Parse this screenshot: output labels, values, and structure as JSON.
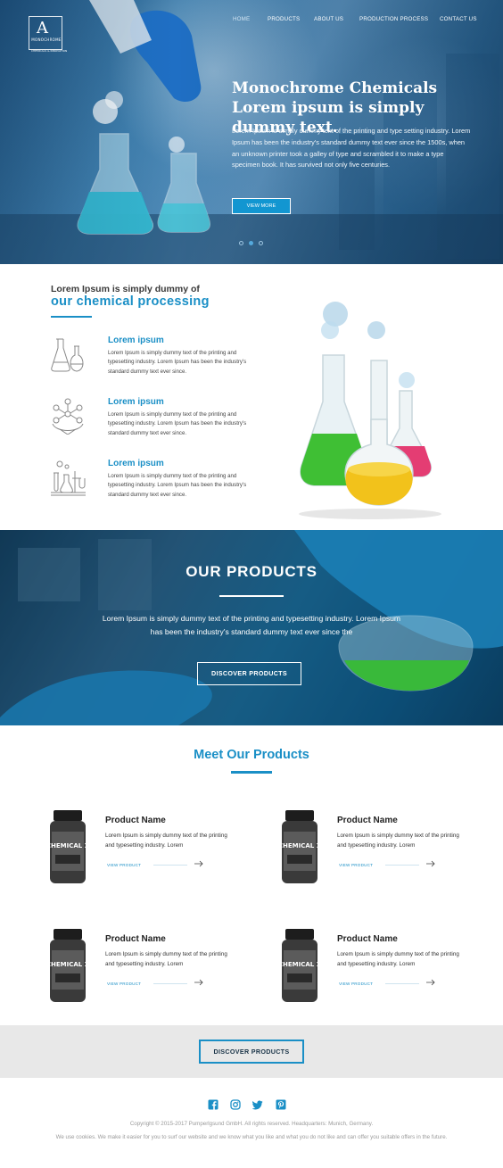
{
  "brand": {
    "logo_mark": "A",
    "name": "MONOCHROME",
    "tagline": "CHEMICALS & INNOVATION"
  },
  "nav": {
    "items": [
      "HOME",
      "PRODUCTS",
      "ABOUT US",
      "PRODUCTION PROCESS",
      "CONTACT US"
    ],
    "active": "HOME"
  },
  "hero": {
    "title": "Monochrome Chemicals Lorem ipsum is simply dummy text.",
    "text": "Lorem Ipsum is simply dummy text of the printing and type setting industry. Lorem Ipsum has been the industry's standard dummy text ever since the 1500s, when an unknown printer took a galley of type and scrambled it to make a type specimen book. It has survived not only five centuries.",
    "button": "VIEW MORE",
    "slides": 3,
    "active_slide": 2
  },
  "processing": {
    "pretitle": "Lorem Ipsum is simply dummy of",
    "title": "our chemical processing",
    "features": [
      {
        "icon": "flasks-icon",
        "title": "Lorem ipsum",
        "text": "Lorem Ipsum is simply dummy text of the printing and typesetting industry. Lorem Ipsum has been the industry's standard dummy text ever since."
      },
      {
        "icon": "molecule-icon",
        "title": "Lorem ipsum",
        "text": "Lorem Ipsum is simply dummy text of the printing and typesetting industry. Lorem Ipsum has been the industry's standard dummy text ever since."
      },
      {
        "icon": "lab-equipment-icon",
        "title": "Lorem ipsum",
        "text": "Lorem Ipsum is simply dummy text of the printing and typesetting industry. Lorem Ipsum has been the industry's standard dummy text ever since."
      }
    ]
  },
  "our_products": {
    "title": "OUR PRODUCTS",
    "text": "Lorem Ipsum is simply dummy text of the printing and typesetting industry. Lorem Ipsum has been the industry's standard dummy text ever since the",
    "button": "DISCOVER PRODUCTS"
  },
  "meet_products": {
    "title": "Meet Our Products",
    "jar_label": "CHEMICAL X",
    "items": [
      {
        "name": "Product Name",
        "text": "Lorem Ipsum is simply dummy text of the printing and typesetting industry. Lorem",
        "link": "VIEW PRODUCT"
      },
      {
        "name": "Product Name",
        "text": "Lorem Ipsum is simply dummy text of the printing and typesetting industry. Lorem",
        "link": "VIEW PRODUCT"
      },
      {
        "name": "Product Name",
        "text": "Lorem Ipsum is simply dummy text of the printing and typesetting industry. Lorem",
        "link": "VIEW PRODUCT"
      },
      {
        "name": "Product Name",
        "text": "Lorem Ipsum is simply dummy text of the printing and typesetting industry. Lorem",
        "link": "VIEW PRODUCT"
      }
    ],
    "button": "DISCOVER PRODUCTS"
  },
  "footer": {
    "social": [
      "facebook-icon",
      "instagram-icon",
      "twitter-icon",
      "pinterest-icon"
    ],
    "copyright": "Copyright © 2015-2017 Pumperlgsund GmbH. All rights reserved. Headquarters: Munich, Germany.",
    "cookies": "We use cookies. We make it easier for you to surf our website and we know what you like and what you do not like and can offer you suitable offers in the future."
  },
  "colors": {
    "accent": "#1a8fc6",
    "hero_button": "#1296d1",
    "strip": "#e8e8e8",
    "footer_text": "#9a9a9a"
  }
}
